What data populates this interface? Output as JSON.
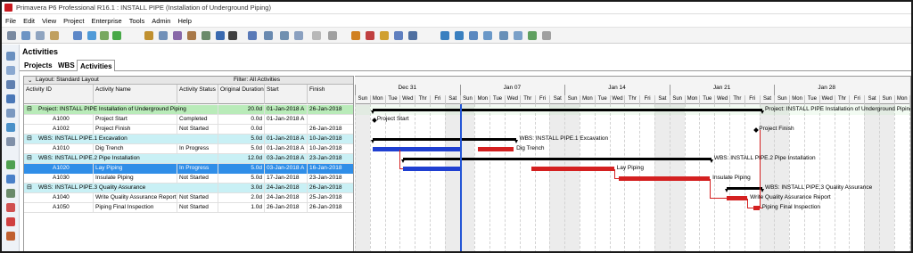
{
  "window": {
    "title": "Primavera P6 Professional R16.1 : INSTALL PIPE (Installation of Underground Piping)"
  },
  "menu": [
    "File",
    "Edit",
    "View",
    "Project",
    "Enterprise",
    "Tools",
    "Admin",
    "Help"
  ],
  "panel": {
    "title": "Activities",
    "tabs": [
      "Projects",
      "WBS",
      "Activities"
    ]
  },
  "grid": {
    "layout": "Layout: Standard Layout",
    "filter": "Filter: All Activities",
    "columns": [
      "Activity ID",
      "Activity Name",
      "Activity Status",
      "Original Duration",
      "Start",
      "Finish"
    ],
    "rows": [
      {
        "type": "proj",
        "id": "Project: INSTALL PIPE  Installation of Underground Piping",
        "name": "",
        "status": "",
        "dur": "20.0d",
        "start": "01-Jan-2018 A",
        "finish": "26-Jan-2018"
      },
      {
        "type": "act",
        "id": "A1000",
        "name": "Project Start",
        "status": "Completed",
        "dur": "0.0d",
        "start": "01-Jan-2018 A",
        "finish": ""
      },
      {
        "type": "act",
        "id": "A1002",
        "name": "Project Finish",
        "status": "Not Started",
        "dur": "0.0d",
        "start": "",
        "finish": "26-Jan-2018"
      },
      {
        "type": "wbs",
        "id": "WBS: INSTALL PIPE.1  Excavation",
        "name": "",
        "status": "",
        "dur": "5.0d",
        "start": "01-Jan-2018 A",
        "finish": "10-Jan-2018"
      },
      {
        "type": "act",
        "id": "A1010",
        "name": "Dig Trench",
        "status": "In Progress",
        "dur": "5.0d",
        "start": "01-Jan-2018 A",
        "finish": "10-Jan-2018"
      },
      {
        "type": "wbs",
        "id": "WBS: INSTALL PIPE.2  Pipe Installation",
        "name": "",
        "status": "",
        "dur": "12.0d",
        "start": "03-Jan-2018 A",
        "finish": "23-Jan-2018"
      },
      {
        "type": "sel",
        "id": "A1020",
        "name": "Lay Piping",
        "status": "In Progress",
        "dur": "5.0d",
        "start": "03-Jan-2018 A",
        "finish": "16-Jan-2018"
      },
      {
        "type": "act",
        "id": "A1030",
        "name": "Insulate Piping",
        "status": "Not Started",
        "dur": "5.0d",
        "start": "17-Jan-2018",
        "finish": "23-Jan-2018"
      },
      {
        "type": "wbs",
        "id": "WBS: INSTALL PIPE.3  Quality Assurance",
        "name": "",
        "status": "",
        "dur": "3.0d",
        "start": "24-Jan-2018",
        "finish": "26-Jan-2018"
      },
      {
        "type": "act",
        "id": "A1040",
        "name": "Write Quality Assurance Report",
        "status": "Not Started",
        "dur": "2.0d",
        "start": "24-Jan-2018",
        "finish": "25-Jan-2018"
      },
      {
        "type": "act",
        "id": "A1050",
        "name": "Piping Final Inspection",
        "status": "Not Started",
        "dur": "1.0d",
        "start": "26-Jan-2018",
        "finish": "26-Jan-2018"
      }
    ]
  },
  "gantt": {
    "weeks": [
      "Dec 31",
      "Jan 07",
      "Jan 14",
      "Jan 21",
      "Jan 28"
    ],
    "days": [
      "Sun",
      "Mon",
      "Tue",
      "Wed",
      "Thr",
      "Fri",
      "Sat"
    ],
    "labels": {
      "proj": "Project: INSTALL PIPE  Installation of Underground Piping",
      "start": "Project Start",
      "finish": "Project Finish",
      "wbs1": "WBS: INSTALL PIPE.1  Excavation",
      "dig": "Dig Trench",
      "wbs2": "WBS: INSTALL PIPE.2  Pipe Installation",
      "lay": "Lay Piping",
      "insulate": "Insulate Piping",
      "wbs3": "WBS: INSTALL PIPE.3  Quality Assurance",
      "qa": "Write Quality Assurance Report",
      "insp": "Piping Final Inspection"
    }
  },
  "colors": {
    "actual": "#1f3fd1",
    "remaining": "#d42020",
    "summary": "#000000",
    "selected": "#2f8ee8",
    "project_row": "#b9ebb9",
    "wbs_row": "#c9f0f5"
  }
}
